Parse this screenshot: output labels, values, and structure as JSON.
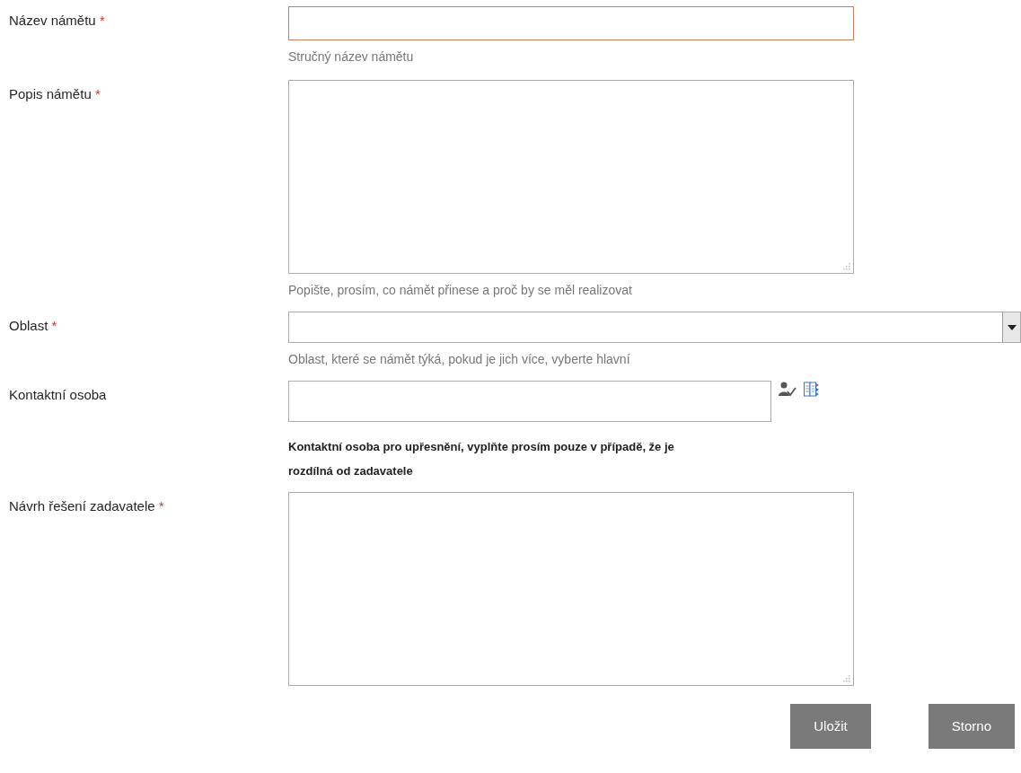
{
  "fields": [
    {
      "label": "Název námětu",
      "required": true,
      "kind": "text",
      "focused": true,
      "hint": "Stručný název námětu",
      "hint_emphasis": false
    },
    {
      "label": "Popis námětu",
      "required": true,
      "kind": "textarea",
      "focused": false,
      "hint": "Popište, prosím, co námět přinese a proč by se měl realizovat",
      "hint_emphasis": false
    },
    {
      "label": "Oblast",
      "required": true,
      "kind": "select",
      "focused": false,
      "hint": "Oblast, které se námět týká, pokud je jich více, vyberte hlavní",
      "hint_emphasis": false
    },
    {
      "label": "Kontaktní osoba",
      "required": false,
      "kind": "people",
      "focused": false,
      "hint": "Kontaktní osoba pro upřesnění, vyplňte prosím pouze v případě, že je rozdílná od zadavatele",
      "hint_emphasis": true
    },
    {
      "label": "Návrh řešení zadavatele",
      "required": true,
      "kind": "textarea",
      "focused": false
    }
  ],
  "required_mark": "*",
  "buttons": [
    "Uložit",
    "Storno"
  ]
}
